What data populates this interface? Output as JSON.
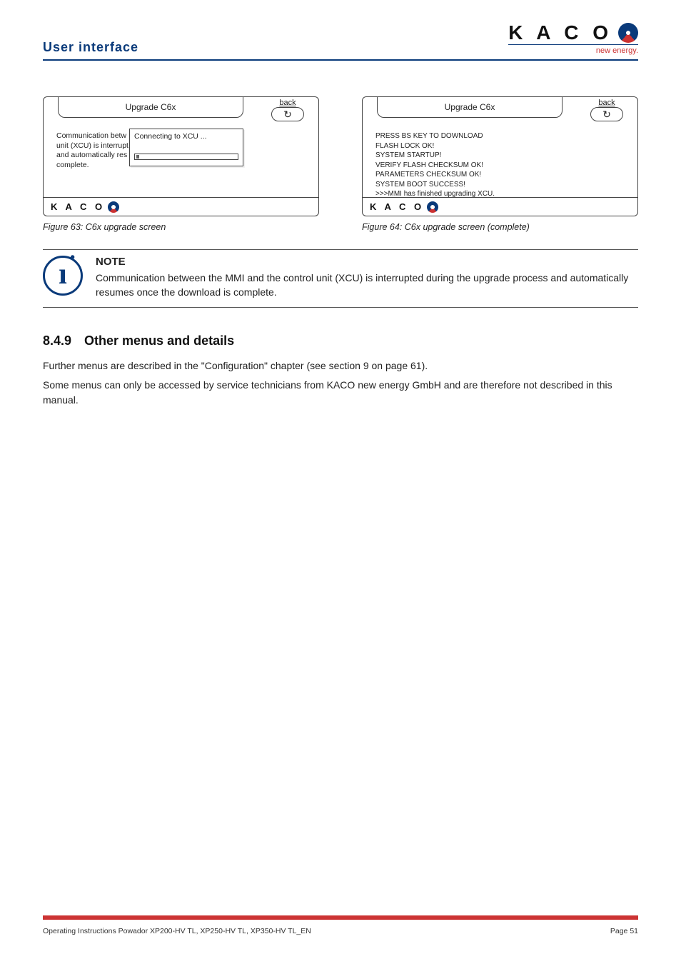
{
  "header": {
    "section_title": "User interface",
    "logo_text": "K A C O",
    "logo_sub": "new energy."
  },
  "figures": {
    "left": {
      "tab_title": "Upgrade C6x",
      "back_label": "back",
      "back_glyph": "↻",
      "under_l1": "Communication betw",
      "under_l2": "unit (XCU) is interrupt",
      "under_l3": "and automatically res",
      "under_l4": "complete.",
      "popup_text": "Connecting to XCU ...",
      "footer": "K A C O",
      "caption": "Figure 63: C6x upgrade screen"
    },
    "right": {
      "tab_title": "Upgrade C6x",
      "back_label": "back",
      "back_glyph": "↻",
      "log_l1": "PRESS BS KEY TO DOWNLOAD",
      "log_l2": "FLASH LOCK OK!",
      "log_l3": "SYSTEM STARTUP!",
      "log_l4": "VERIFY FLASH CHECKSUM OK!",
      "log_l5": "PARAMETERS CHECKSUM OK!",
      "log_l6": "SYSTEM BOOT SUCCESS!",
      "log_l7": ">>>MMI has finished upgrading XCU.",
      "footer": "K A C O",
      "caption": "Figure 64:  C6x upgrade screen (complete)"
    }
  },
  "note": {
    "heading": "NOTE",
    "text": "Communication between the MMI and the control unit (XCU) is interrupted during the upgrade process and automatically resumes once the download is complete."
  },
  "section": {
    "number": "8.4.9",
    "title": "Other menus and details",
    "p1": "Further menus are described in the \"Configuration\" chapter (see section 9 on page 61).",
    "p2": "Some menus can only be accessed by service technicians from KACO new energy GmbH and are therefore not described in this manual."
  },
  "footer": {
    "left": "Operating Instructions Powador XP200-HV TL, XP250-HV TL, XP350-HV TL_EN",
    "right": "Page 51"
  }
}
